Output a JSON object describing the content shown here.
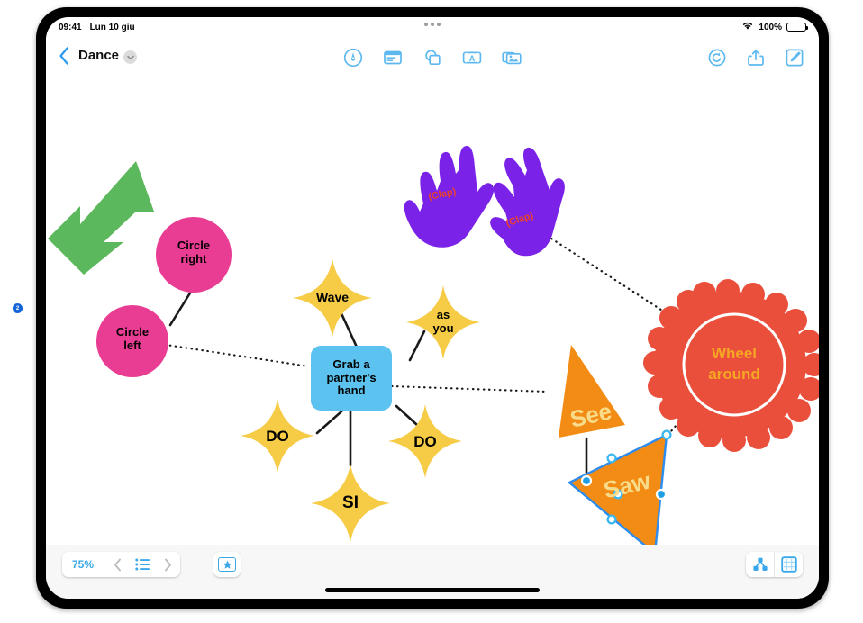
{
  "status_bar": {
    "time": "09:41",
    "date": "Lun 10 giu",
    "battery_percent": "100%",
    "wifi_icon": "wifi-icon",
    "battery_icon": "battery-icon",
    "more_icon": "ellipsis-icon"
  },
  "nav_bar": {
    "back_icon": "chevron-left-icon",
    "title": "Dance",
    "title_chevron_icon": "chevron-down-icon",
    "center_tools": [
      {
        "name": "markup-pen-tool",
        "icon": "pen-in-circle-icon",
        "label": "Markup"
      },
      {
        "name": "table-tool",
        "icon": "table-icon",
        "label": "Table"
      },
      {
        "name": "shapes-tool",
        "icon": "shapes-icon",
        "label": "Shapes"
      },
      {
        "name": "text-box-tool",
        "icon": "text-a-icon",
        "label": "Text"
      },
      {
        "name": "media-tool",
        "icon": "photo-stack-icon",
        "label": "Media"
      }
    ],
    "right_tools": [
      {
        "name": "undo-button",
        "icon": "undo-arrow-icon",
        "label": "Undo"
      },
      {
        "name": "share-button",
        "icon": "share-up-arrow-icon",
        "label": "Share"
      },
      {
        "name": "compose-button",
        "icon": "pencil-square-icon",
        "label": "Compose"
      }
    ]
  },
  "bottom_bar": {
    "zoom_level": "75%",
    "prev_icon": "chevron-left-icon",
    "page_list_icon": "list-bullet-icon",
    "next_icon": "chevron-right-icon",
    "star_icon": "star-icon",
    "organize_icon": "hierarchy-icon",
    "format_icon": "format-panel-icon"
  },
  "canvas": {
    "background": "#ffffff",
    "colors": {
      "pink": "#e93d94",
      "yellow": "#f6cb45",
      "blue": "#5cc2ef",
      "orange": "#f28c14",
      "red": "#ea4f3c",
      "purple": "#7b22e8",
      "green": "#5cb85c",
      "orange_text": "#f5a623",
      "clap_text": "#e8422c",
      "selection_blue": "#2d8cf0",
      "star_text": "#111111"
    },
    "shapes": [
      {
        "name": "green-arrow-shape",
        "type": "arrow",
        "label": "",
        "color": "#5cb85c"
      },
      {
        "name": "circle-right-node",
        "type": "circle",
        "label": "Circle\nright",
        "color": "#e93d94"
      },
      {
        "name": "circle-left-node",
        "type": "circle",
        "label": "Circle\nleft",
        "color": "#e93d94"
      },
      {
        "name": "clapping-hands-shape",
        "type": "hands",
        "label": "(Clap)",
        "color": "#7b22e8"
      },
      {
        "name": "wave-star-node",
        "type": "star4",
        "label": "Wave",
        "color": "#f6cb45"
      },
      {
        "name": "as-you-star-node",
        "type": "star4",
        "label": "as\nyou",
        "color": "#f6cb45"
      },
      {
        "name": "grab-partner-hand-node",
        "type": "rounded-rect",
        "label": "Grab a\npartner's\nhand",
        "color": "#5cc2ef"
      },
      {
        "name": "do-left-star-node",
        "type": "star4",
        "label": "DO",
        "color": "#f6cb45"
      },
      {
        "name": "si-star-node",
        "type": "star4",
        "label": "SI",
        "color": "#f6cb45"
      },
      {
        "name": "do-right-star-node",
        "type": "star4",
        "label": "DO",
        "color": "#f6cb45"
      },
      {
        "name": "see-triangle-shape",
        "type": "triangle",
        "label": "See",
        "color": "#f28c14"
      },
      {
        "name": "saw-triangle-shape",
        "type": "triangle",
        "label": "Saw",
        "color": "#f28c14",
        "selected": true
      },
      {
        "name": "wheel-around-badge",
        "type": "scalloped-badge",
        "label": "Wheel\naround",
        "color": "#ea4f3c"
      }
    ],
    "labels": {
      "circle_right": "Circle right",
      "circle_right_line1": "Circle",
      "circle_right_line2": "right",
      "circle_left_line1": "Circle",
      "circle_left_line2": "left",
      "clap_1": "(Clap)",
      "clap_2": "(Clap)",
      "wave": "Wave",
      "as_you_line1": "as",
      "as_you_line2": "you",
      "grab_line1": "Grab a",
      "grab_line2": "partner's",
      "grab_line3": "hand",
      "do_left": "DO",
      "si": "SI",
      "do_right": "DO",
      "see": "See",
      "saw": "Saw",
      "wheel_line1": "Wheel",
      "wheel_line2": "around"
    }
  }
}
